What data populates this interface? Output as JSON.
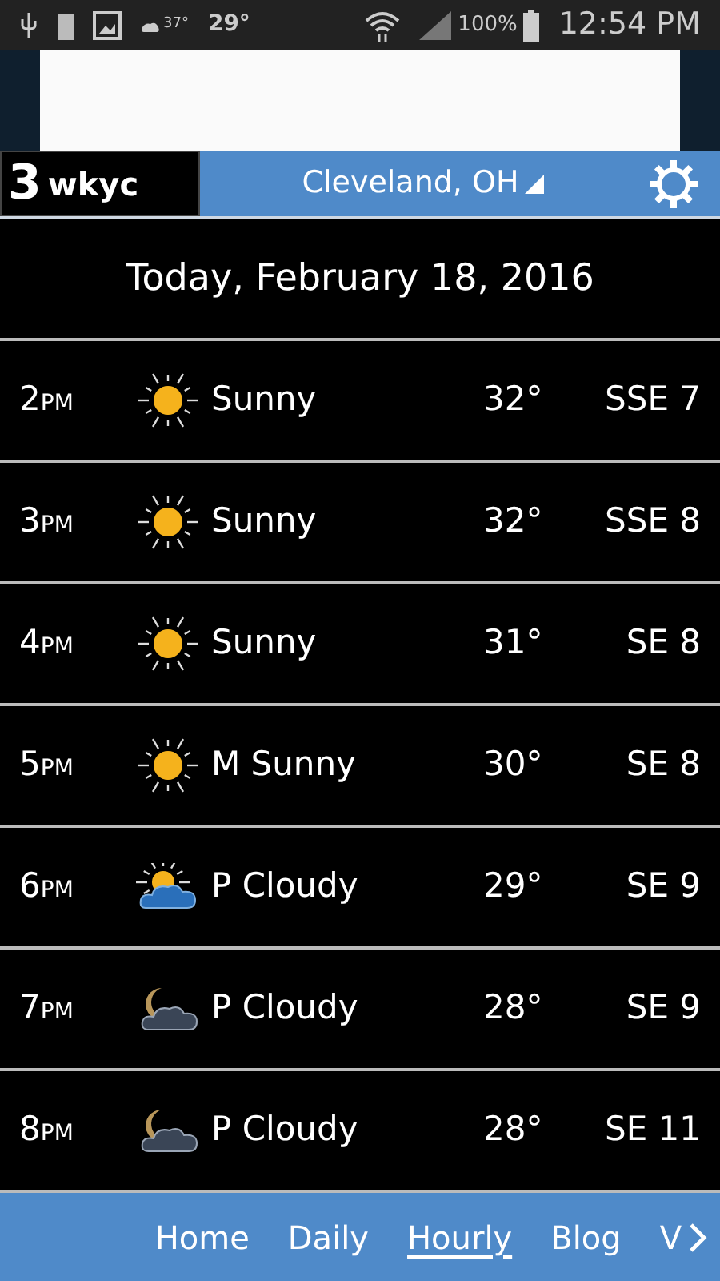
{
  "status_bar": {
    "weather_temp": "37°",
    "temp": "29°",
    "battery": "100%",
    "time": "12:54 PM"
  },
  "header": {
    "logo_number": "3",
    "logo_text": "wkyc",
    "location": "Cleveland, OH"
  },
  "date": "Today, February 18, 2016",
  "rows": [
    {
      "hour": "2",
      "period": "PM",
      "kind": "sun",
      "condition": "Sunny",
      "temp": "32°",
      "wind": "SSE 7"
    },
    {
      "hour": "3",
      "period": "PM",
      "kind": "sun",
      "condition": "Sunny",
      "temp": "32°",
      "wind": "SSE 8"
    },
    {
      "hour": "4",
      "period": "PM",
      "kind": "sun",
      "condition": "Sunny",
      "temp": "31°",
      "wind": "SE 8"
    },
    {
      "hour": "5",
      "period": "PM",
      "kind": "sun",
      "condition": "M Sunny",
      "temp": "30°",
      "wind": "SE 8"
    },
    {
      "hour": "6",
      "period": "PM",
      "kind": "sun-cloud",
      "condition": "P Cloudy",
      "temp": "29°",
      "wind": "SE 9"
    },
    {
      "hour": "7",
      "period": "PM",
      "kind": "moon-cloud",
      "condition": "P Cloudy",
      "temp": "28°",
      "wind": "SE 9"
    },
    {
      "hour": "8",
      "period": "PM",
      "kind": "moon-cloud",
      "condition": "P Cloudy",
      "temp": "28°",
      "wind": "SE 11"
    }
  ],
  "nav": [
    {
      "label": "Home",
      "selected": false
    },
    {
      "label": "Daily",
      "selected": false
    },
    {
      "label": "Hourly",
      "selected": true
    },
    {
      "label": "Blog",
      "selected": false
    },
    {
      "label": "V",
      "selected": false
    }
  ]
}
